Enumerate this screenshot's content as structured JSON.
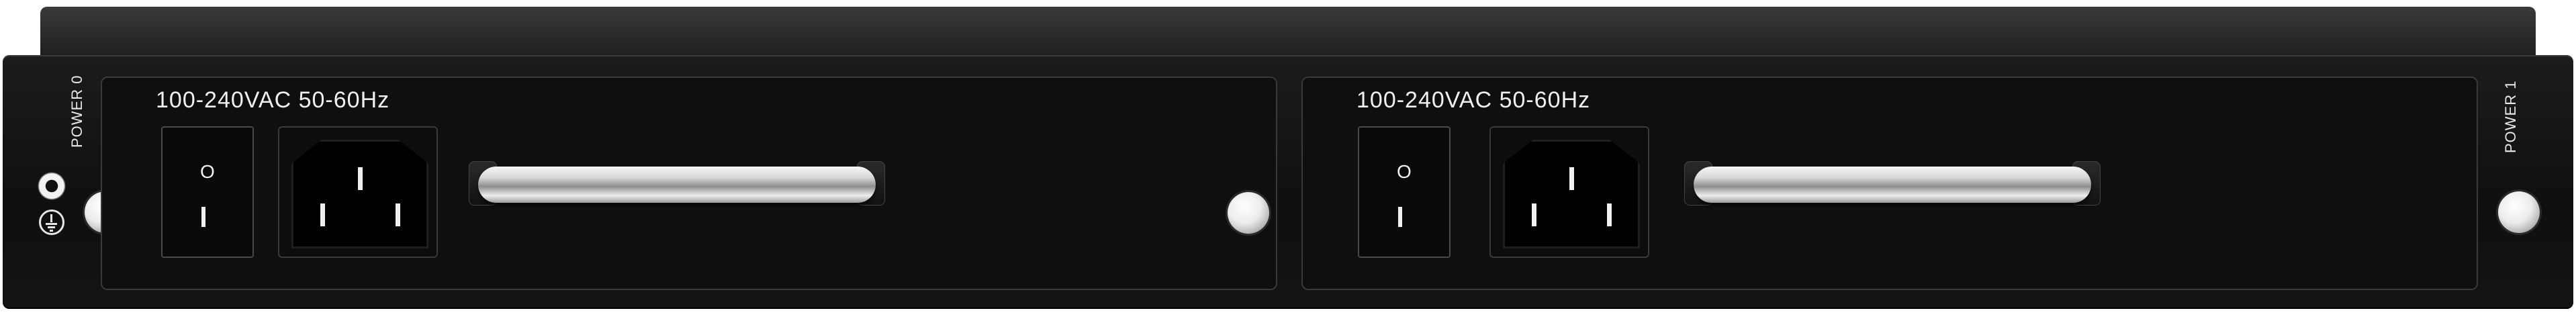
{
  "chassis": {
    "power_labels": {
      "left": "POWER 0",
      "right": "POWER 1"
    }
  },
  "modules": [
    {
      "rating": "100-240VAC 50-60Hz",
      "switch": {
        "off_mark": "O"
      }
    },
    {
      "rating": "100-240VAC 50-60Hz",
      "switch": {
        "off_mark": "O"
      }
    }
  ],
  "icons": {
    "ground": "ground-icon",
    "ground_jack": "ground-jack-icon",
    "screw": "thumbscrew-icon",
    "handle": "handle-icon",
    "power_inlet": "iec-c14-inlet-icon"
  }
}
